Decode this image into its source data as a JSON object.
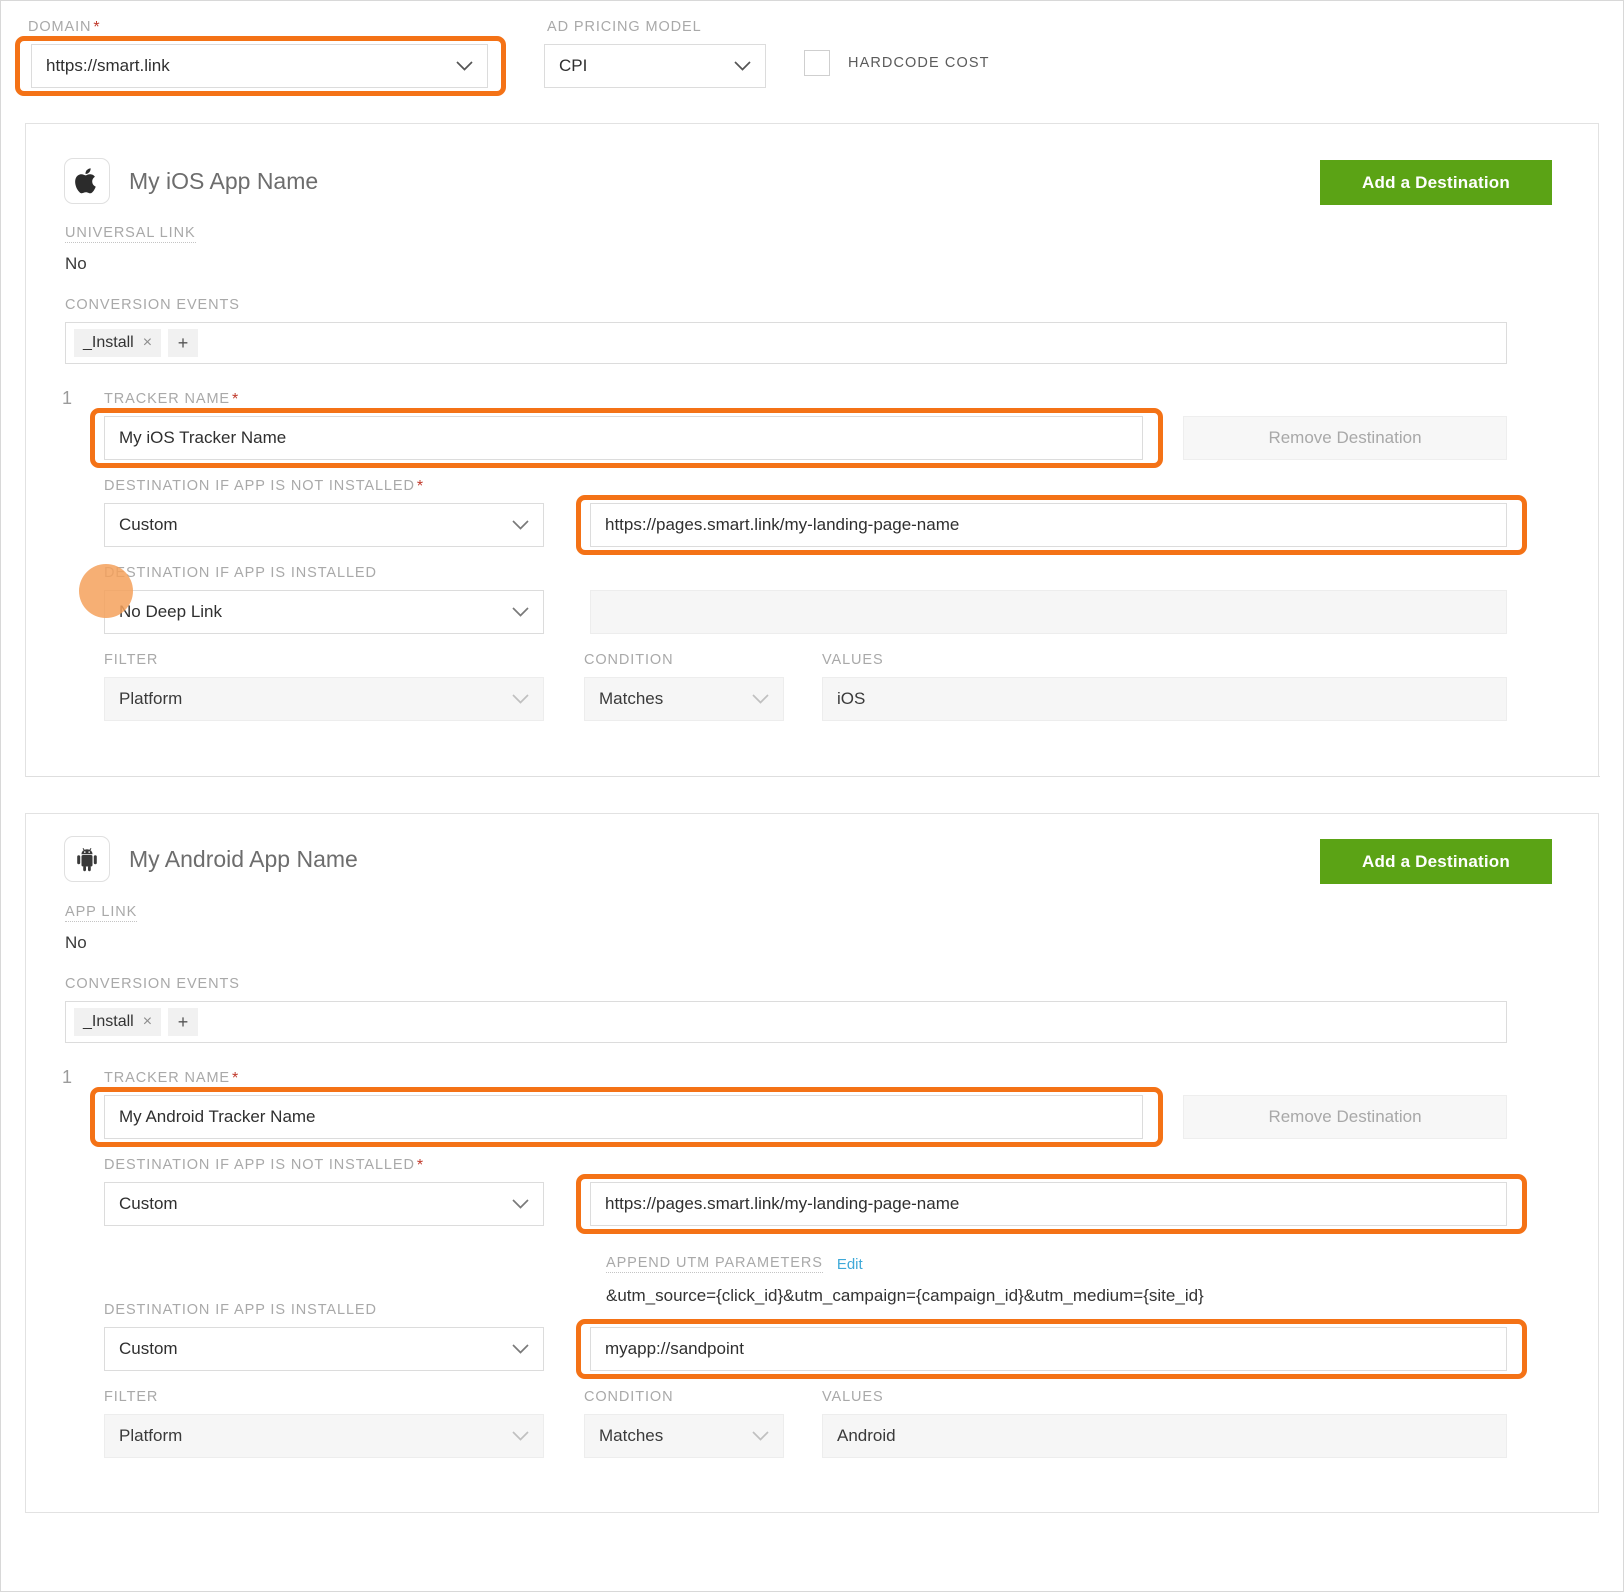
{
  "top_bar": {
    "domain": {
      "label": "DOMAIN",
      "required": true,
      "value": "https://smart.link",
      "highlighted": true
    },
    "ad_pricing_model": {
      "label": "AD PRICING MODEL",
      "required": false,
      "value": "CPI"
    },
    "hardcode_cost": {
      "label": "HARDCODE COST",
      "checked": false
    }
  },
  "colors": {
    "accent_orange": "#f47216",
    "button_green": "#5ba315",
    "link_blue": "#3fa9d8",
    "required_red": "#c0392b",
    "cursor_dot": "#f5a15c"
  },
  "platforms": [
    {
      "id": "ios",
      "icon": "apple-icon",
      "app_name": "My iOS App Name",
      "add_destination_label": "Add a Destination",
      "link_type_label": "UNIVERSAL LINK",
      "link_type_value": "No",
      "conversion_events_label": "CONVERSION EVENTS",
      "conversion_events": [
        "_Install"
      ],
      "add_event_label": "+",
      "destinations": [
        {
          "index": "1",
          "tracker_name_label": "TRACKER NAME",
          "tracker_name_value": "My iOS Tracker Name",
          "tracker_name_highlighted": true,
          "remove_label": "Remove Destination",
          "not_installed_label": "DESTINATION IF APP IS NOT INSTALLED",
          "not_installed_type": "Custom",
          "not_installed_url": "https://pages.smart.link/my-landing-page-name",
          "not_installed_url_highlighted": true,
          "installed_label": "DESTINATION IF APP IS INSTALLED",
          "installed_type": "No Deep Link",
          "installed_url": "",
          "installed_url_disabled": true,
          "utm": null,
          "filter_label": "FILTER",
          "filter_value": "Platform",
          "condition_label": "CONDITION",
          "condition_value": "Matches",
          "values_label": "VALUES",
          "values_value": "iOS"
        }
      ]
    },
    {
      "id": "android",
      "icon": "android-icon",
      "app_name": "My Android App Name",
      "add_destination_label": "Add a Destination",
      "link_type_label": "APP LINK",
      "link_type_value": "No",
      "conversion_events_label": "CONVERSION EVENTS",
      "conversion_events": [
        "_Install"
      ],
      "add_event_label": "+",
      "destinations": [
        {
          "index": "1",
          "tracker_name_label": "TRACKER NAME",
          "tracker_name_value": "My Android Tracker Name",
          "tracker_name_highlighted": true,
          "remove_label": "Remove Destination",
          "not_installed_label": "DESTINATION IF APP IS NOT INSTALLED",
          "not_installed_type": "Custom",
          "not_installed_url": "https://pages.smart.link/my-landing-page-name",
          "not_installed_url_highlighted": true,
          "installed_label": "DESTINATION IF APP IS INSTALLED",
          "installed_type": "Custom",
          "installed_url": "myapp://sandpoint",
          "installed_url_disabled": false,
          "utm": {
            "label": "APPEND UTM PARAMETERS",
            "edit_label": "Edit",
            "value": "&utm_source={click_id}&utm_campaign={campaign_id}&utm_medium={site_id}"
          },
          "filter_label": "FILTER",
          "filter_value": "Platform",
          "condition_label": "CONDITION",
          "condition_value": "Matches",
          "values_label": "VALUES",
          "values_value": "Android"
        }
      ]
    }
  ]
}
